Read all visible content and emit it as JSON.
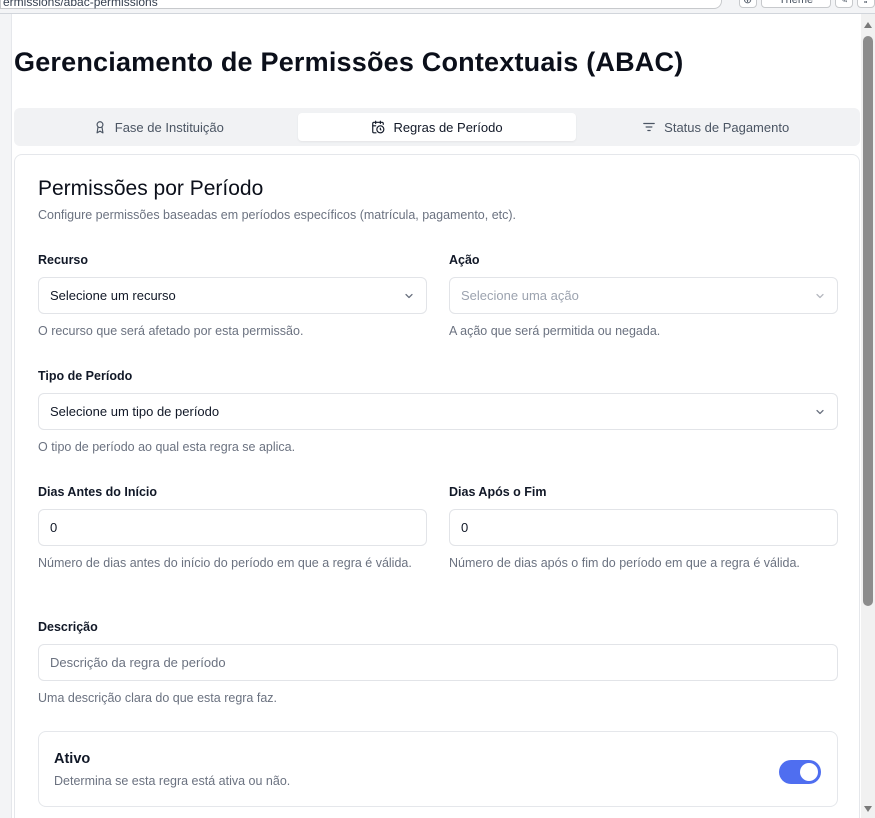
{
  "browser": {
    "url_fragment": "ermissions/abac-permissions",
    "theme_label": "Theme"
  },
  "page": {
    "title": "Gerenciamento de Permissões Contextuais (ABAC)"
  },
  "tabs": [
    {
      "label": "Fase de Instituição",
      "icon": "award-icon",
      "active": false
    },
    {
      "label": "Regras de Período",
      "icon": "calendar-clock-icon",
      "active": true
    },
    {
      "label": "Status de Pagamento",
      "icon": "filter-lines-icon",
      "active": false
    }
  ],
  "card": {
    "title": "Permissões por Período",
    "description": "Configure permissões baseadas em períodos específicos (matrícula, pagamento, etc)."
  },
  "form": {
    "resource": {
      "label": "Recurso",
      "value": "Selecione um recurso",
      "helper": "O recurso que será afetado por esta permissão."
    },
    "action": {
      "label": "Ação",
      "placeholder": "Selecione uma ação",
      "helper": "A ação que será permitida ou negada.",
      "disabled": true
    },
    "period_type": {
      "label": "Tipo de Período",
      "value": "Selecione um tipo de período",
      "helper": "O tipo de período ao qual esta regra se aplica."
    },
    "days_before": {
      "label": "Dias Antes do Início",
      "value": "0",
      "helper": "Número de dias antes do início do período em que a regra é válida."
    },
    "days_after": {
      "label": "Dias Após o Fim",
      "value": "0",
      "helper": "Número de dias após o fim do período em que a regra é válida."
    },
    "description": {
      "label": "Descrição",
      "placeholder": "Descrição da regra de período",
      "helper": "Uma descrição clara do que esta regra faz."
    },
    "active": {
      "title": "Ativo",
      "description": "Determina se esta regra está ativa ou não.",
      "checked": true
    }
  },
  "colors": {
    "accent": "#4f6ef0",
    "muted_text": "#6b7280",
    "border": "#e5e7eb"
  }
}
